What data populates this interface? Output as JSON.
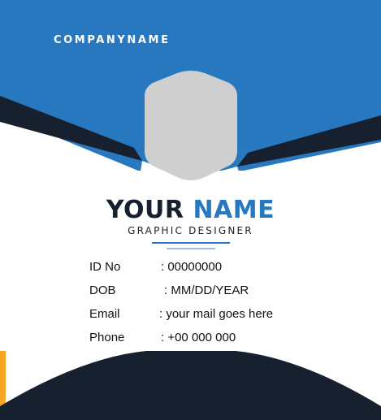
{
  "card": {
    "company_name": "COMPANYNAME",
    "name_first": "YOUR",
    "name_last": "NAME",
    "job_title": "GRAPHIC DESIGNER",
    "photo_placeholder_icon": "hexagon-photo-placeholder",
    "fields": [
      {
        "label": "ID No",
        "value": ": 00000000"
      },
      {
        "label": "DOB",
        "value": ": MM/DD/YEAR"
      },
      {
        "label": "Email",
        "value": ": your mail goes here"
      },
      {
        "label": "Phone",
        "value": ": +00 000 000"
      }
    ]
  },
  "colors": {
    "blue": "#2878bf",
    "navy": "#17202e",
    "orange": "#f5a623",
    "photo_gray": "#cfcfcf",
    "white": "#ffffff"
  }
}
